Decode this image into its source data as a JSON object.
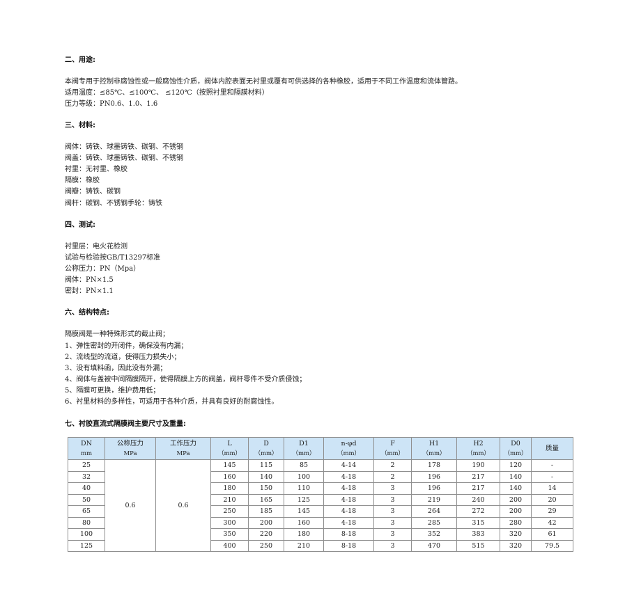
{
  "sections": {
    "usage": {
      "heading": "二、用途:",
      "lines": [
        "本阀专用于控制非腐蚀性或一般腐蚀性介质，阀体内腔表面无衬里或覆有可供选择的各种橡胶，适用于不同工作温度和流体管路。",
        "适用温度：≤85℃、≤100℃、 ≤120℃（按照衬里和隔膜材料）",
        "压力等级：PN0.6、1.0、1.6"
      ]
    },
    "materials": {
      "heading": "三、材料:",
      "lines": [
        "阀体：铸铁、球墨铸铁、碳钢、不锈钢",
        "阀盖：铸铁、球墨铸铁、碳钢、不锈钢",
        "衬里：无衬里、橡胶",
        "隔膜：橡胶",
        "阀瓣：铸铁、碳钢",
        "阀杆：碳钢、不锈钢手轮：铸铁"
      ]
    },
    "testing": {
      "heading": "四、测试:",
      "lines": [
        "衬里层：电火花检测",
        "试验与检验按GB/T13297标准",
        "公称压力：PN（Mpa）",
        "阀体：PN×1.5",
        "密封：PN×1.1"
      ]
    },
    "features": {
      "heading": "六、结构特点:",
      "lines": [
        "隔膜阀是一种特殊形式的截止阀；",
        "1、弹性密封的开闭件，确保没有内漏；",
        "2、流线型的流道，使得压力损失小；",
        "3、没有填料函，因此没有外漏；",
        "4、阀体与盖被中间隔膜隔开，使得隔膜上方的阀盖，阀杆零件不受介质侵蚀；",
        "5、隔膜可更换，维护费用低；",
        "6、衬里材料的多样性，可适用于各种介质，并具有良好的耐腐蚀性。"
      ]
    },
    "dimensions": {
      "heading": "七、衬胶直流式隔膜阀主要尺寸及重量:"
    }
  },
  "table": {
    "headers": [
      {
        "top": "DN",
        "sub": "mm"
      },
      {
        "top": "公称压力",
        "sub": "MPa"
      },
      {
        "top": "工作压力",
        "sub": "MPa"
      },
      {
        "top": "L",
        "sub": "（mm）"
      },
      {
        "top": "D",
        "sub": "（mm）"
      },
      {
        "top": "D1",
        "sub": "（mm）"
      },
      {
        "top": "n-φd",
        "sub": "（mm）"
      },
      {
        "top": "F",
        "sub": "（mm）"
      },
      {
        "top": "H1",
        "sub": "（mm）"
      },
      {
        "top": "H2",
        "sub": "（mm）"
      },
      {
        "top": "D0",
        "sub": "（mm）"
      },
      {
        "top": "质量",
        "sub": ""
      }
    ],
    "nominal_pressure": "0.6",
    "working_pressure": "0.6",
    "rows": [
      [
        "25",
        "145",
        "115",
        "85",
        "4-14",
        "2",
        "178",
        "190",
        "120",
        "-"
      ],
      [
        "32",
        "160",
        "140",
        "100",
        "4-18",
        "2",
        "196",
        "217",
        "140",
        "-"
      ],
      [
        "40",
        "180",
        "150",
        "110",
        "4-18",
        "3",
        "196",
        "217",
        "140",
        "14"
      ],
      [
        "50",
        "210",
        "165",
        "125",
        "4-18",
        "3",
        "219",
        "240",
        "200",
        "20"
      ],
      [
        "65",
        "250",
        "185",
        "145",
        "4-18",
        "3",
        "264",
        "272",
        "200",
        "29"
      ],
      [
        "80",
        "300",
        "200",
        "160",
        "4-18",
        "3",
        "285",
        "315",
        "280",
        "42"
      ],
      [
        "100",
        "350",
        "220",
        "180",
        "8-18",
        "3",
        "352",
        "383",
        "320",
        "61"
      ],
      [
        "125",
        "400",
        "250",
        "210",
        "8-18",
        "3",
        "470",
        "515",
        "320",
        "79.5"
      ]
    ]
  },
  "colors": {
    "header_bg": "#cde4f6",
    "border": "#8f8f8f"
  }
}
